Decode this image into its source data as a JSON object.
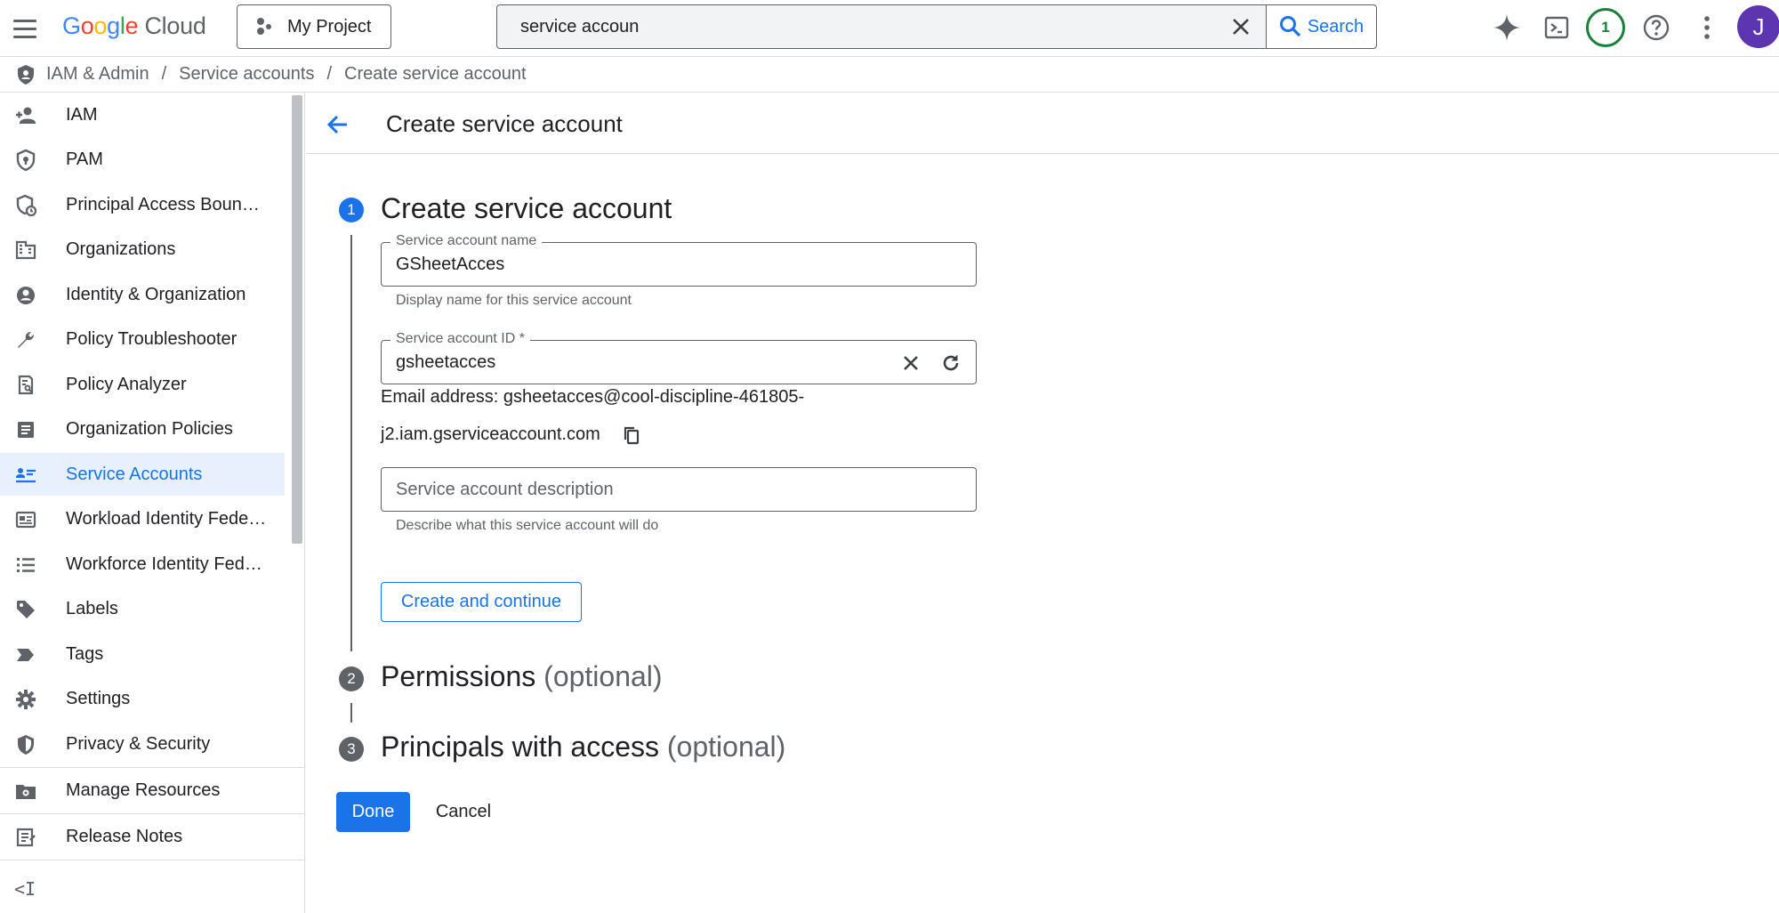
{
  "app": {
    "logo_parts": [
      "G",
      "o",
      "o",
      "g",
      "l",
      "e"
    ],
    "logo_suffix": "Cloud",
    "project_label": "My Project"
  },
  "search": {
    "value": "service accoun",
    "placeholder": "Search",
    "button_label": "Search"
  },
  "topbar": {
    "notification_count": "1",
    "avatar_initial": "J"
  },
  "breadcrumb": {
    "items": [
      "IAM & Admin",
      "Service accounts",
      "Create service account"
    ],
    "separator": "/"
  },
  "sidebar": {
    "items": [
      {
        "label": "IAM",
        "icon": "person-add-icon"
      },
      {
        "label": "PAM",
        "icon": "shield-lock-icon"
      },
      {
        "label": "Principal Access Boun…",
        "icon": "shield-policy-icon"
      },
      {
        "label": "Organizations",
        "icon": "building-icon"
      },
      {
        "label": "Identity & Organization",
        "icon": "account-circle-icon"
      },
      {
        "label": "Policy Troubleshooter",
        "icon": "wrench-icon"
      },
      {
        "label": "Policy Analyzer",
        "icon": "document-search-icon"
      },
      {
        "label": "Organization Policies",
        "icon": "list-document-icon"
      },
      {
        "label": "Service Accounts",
        "icon": "service-account-icon",
        "active": true
      },
      {
        "label": "Workload Identity Fede…",
        "icon": "id-card-icon"
      },
      {
        "label": "Workforce Identity Fed…",
        "icon": "list-icon"
      },
      {
        "label": "Labels",
        "icon": "tag-icon"
      },
      {
        "label": "Tags",
        "icon": "label-arrow-icon"
      },
      {
        "label": "Settings",
        "icon": "gear-icon"
      },
      {
        "label": "Privacy & Security",
        "icon": "shield-icon"
      }
    ],
    "fixed": [
      {
        "label": "Manage Resources",
        "icon": "folder-gear-icon"
      },
      {
        "label": "Release Notes",
        "icon": "notes-icon"
      }
    ],
    "collapse_label": "<I"
  },
  "page": {
    "title": "Create service account",
    "steps": [
      {
        "number": "1",
        "title": "Create service account",
        "optional": ""
      },
      {
        "number": "2",
        "title": "Permissions",
        "optional": "(optional)"
      },
      {
        "number": "3",
        "title": "Principals with access",
        "optional": "(optional)"
      }
    ],
    "form": {
      "name_label": "Service account name",
      "name_value": "GSheetAcces",
      "name_hint": "Display name for this service account",
      "id_label": "Service account ID *",
      "id_value": "gsheetacces",
      "email_line1": "Email address: gsheetacces@cool-discipline-461805-",
      "email_line2": "j2.iam.gserviceaccount.com",
      "description_placeholder": "Service account description",
      "description_hint": "Describe what this service account will do"
    },
    "buttons": {
      "create_continue": "Create and continue",
      "done": "Done",
      "cancel": "Cancel"
    }
  },
  "colors": {
    "accent": "#1a73e8",
    "active_bg": "#e8f0fe",
    "step_inactive": "#5f6368",
    "notification": "#188038",
    "avatar": "#5e35b1"
  }
}
